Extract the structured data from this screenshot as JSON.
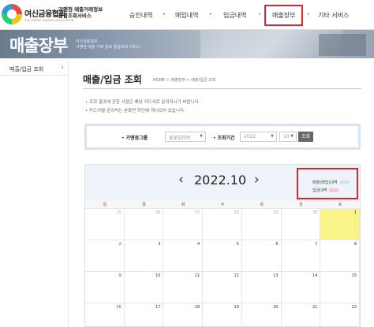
{
  "header": {
    "logo_name": "여신금융협회",
    "logo_sub": "THE CREDIT FINANCE ASSOCIATION",
    "service_title_lines": [
      "가맹점 매출거래정보",
      "통합조회서비스"
    ],
    "nav": [
      "승인내역",
      "매입내역",
      "입금내역",
      "매출장부",
      "기타 서비스"
    ],
    "active_nav_index": 3
  },
  "banner": {
    "title": "매출장부",
    "sub_lines": [
      "여신금융협회",
      "가맹점 매출 거래 정보 통합조회 서비스"
    ]
  },
  "sidebar": {
    "items": [
      {
        "label": "매출/입금 조회",
        "arrow": "›"
      }
    ]
  },
  "main": {
    "page_title": "매출/입금 조회",
    "breadcrumb": "HOME > 매출장부 > 매출/입금 조회",
    "notes": [
      "• 조회 결과에 관한 사항은 해당 카드사로 문의하시기 바랍니다.",
      "• 카드사별 문의처는 본화면 하단에 게시되어 있습니다."
    ]
  },
  "search": {
    "store_group_label": "가맹점그룹",
    "store_group_value": "불꽃밀피버",
    "period_label": "조회기간",
    "year_value": "2022",
    "month_value": "10",
    "button_label": "조회"
  },
  "calendar": {
    "prev": "‹",
    "next": "›",
    "month_label": "2022.10",
    "legend": [
      {
        "label": "매출(매입)내역",
        "color": "#cfe4f7"
      },
      {
        "label": "입금내역",
        "color": "#f7c9cf"
      }
    ],
    "weekdays": [
      "일",
      "월",
      "화",
      "수",
      "목",
      "금",
      "토"
    ],
    "weeks": [
      [
        "25",
        "26",
        "27",
        "28",
        "29",
        "30",
        "1"
      ],
      [
        "2",
        "3",
        "4",
        "5",
        "6",
        "7",
        "8"
      ],
      [
        "9",
        "10",
        "11",
        "12",
        "13",
        "14",
        "15"
      ],
      [
        "16",
        "17",
        "18",
        "19",
        "20",
        "21",
        "22"
      ]
    ],
    "highlight": {
      "week": 0,
      "day": 6,
      "color": "#fbf48b"
    }
  },
  "colors": {
    "highlight_red": "#d9262c",
    "search_border": "#d5e3f2",
    "calendar_head_bg": "#eef3f9"
  }
}
